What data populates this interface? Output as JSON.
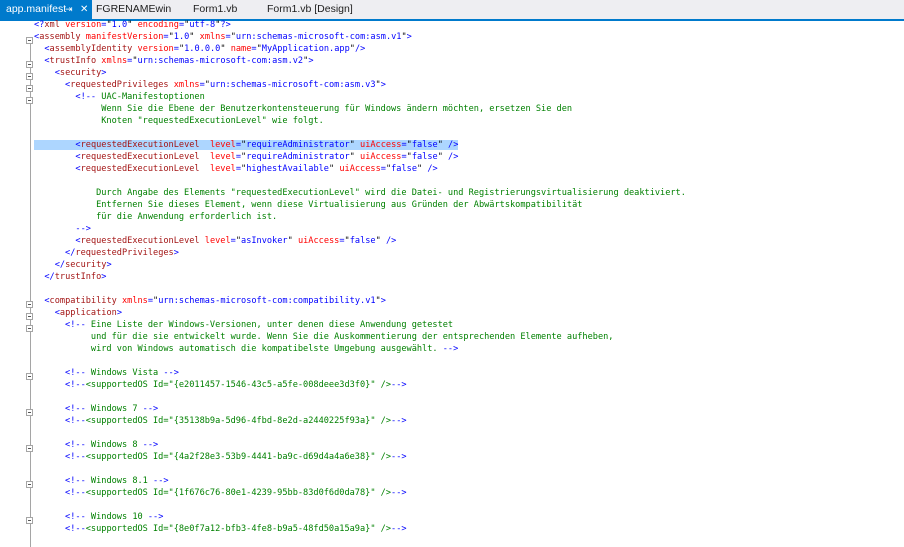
{
  "tabs": [
    {
      "label": "app.manifest",
      "active": true,
      "pin_glyph": "⇥",
      "close_glyph": "✕"
    },
    {
      "label": "FGRENAMEwin",
      "active": false
    },
    {
      "label": "Form1.vb",
      "active": false
    },
    {
      "label": "Form1.vb [Design]",
      "active": false
    }
  ],
  "colors": {
    "accent": "#007acc",
    "selection": "#add6ff",
    "element": "#a31515",
    "attribute": "#ff0000",
    "value": "#0000ff",
    "comment": "#008000"
  },
  "lines": [
    [
      [
        "b",
        "<?"
      ],
      [
        "e",
        "xml"
      ],
      [
        "a",
        " version"
      ],
      [
        "b",
        "="
      ],
      [
        "t",
        "\""
      ],
      [
        "v",
        "1.0"
      ],
      [
        "t",
        "\""
      ],
      [
        "a",
        " encoding"
      ],
      [
        "b",
        "="
      ],
      [
        "t",
        "\""
      ],
      [
        "v",
        "utf-8"
      ],
      [
        "t",
        "\""
      ],
      [
        "b",
        "?>"
      ]
    ],
    [
      [
        "b",
        "<"
      ],
      [
        "e",
        "assembly"
      ],
      [
        "a",
        " manifestVersion"
      ],
      [
        "b",
        "="
      ],
      [
        "t",
        "\""
      ],
      [
        "v",
        "1.0"
      ],
      [
        "t",
        "\""
      ],
      [
        "a",
        " xmlns"
      ],
      [
        "b",
        "="
      ],
      [
        "t",
        "\""
      ],
      [
        "v",
        "urn:schemas-microsoft-com:asm.v1"
      ],
      [
        "t",
        "\""
      ],
      [
        "b",
        ">"
      ]
    ],
    [
      [
        "t",
        "  "
      ],
      [
        "b",
        "<"
      ],
      [
        "e",
        "assemblyIdentity"
      ],
      [
        "a",
        " version"
      ],
      [
        "b",
        "="
      ],
      [
        "t",
        "\""
      ],
      [
        "v",
        "1.0.0.0"
      ],
      [
        "t",
        "\""
      ],
      [
        "a",
        " name"
      ],
      [
        "b",
        "="
      ],
      [
        "t",
        "\""
      ],
      [
        "v",
        "MyApplication.app"
      ],
      [
        "t",
        "\""
      ],
      [
        "b",
        "/>"
      ]
    ],
    [
      [
        "t",
        "  "
      ],
      [
        "b",
        "<"
      ],
      [
        "e",
        "trustInfo"
      ],
      [
        "a",
        " xmlns"
      ],
      [
        "b",
        "="
      ],
      [
        "t",
        "\""
      ],
      [
        "v",
        "urn:schemas-microsoft-com:asm.v2"
      ],
      [
        "t",
        "\""
      ],
      [
        "b",
        ">"
      ]
    ],
    [
      [
        "t",
        "    "
      ],
      [
        "b",
        "<"
      ],
      [
        "e",
        "security"
      ],
      [
        "b",
        ">"
      ]
    ],
    [
      [
        "t",
        "      "
      ],
      [
        "b",
        "<"
      ],
      [
        "e",
        "requestedPrivileges"
      ],
      [
        "a",
        " xmlns"
      ],
      [
        "b",
        "="
      ],
      [
        "t",
        "\""
      ],
      [
        "v",
        "urn:schemas-microsoft-com:asm.v3"
      ],
      [
        "t",
        "\""
      ],
      [
        "b",
        ">"
      ]
    ],
    [
      [
        "t",
        "        "
      ],
      [
        "b",
        "<!--"
      ],
      [
        "c",
        " UAC-Manifestoptionen"
      ]
    ],
    [
      [
        "c",
        "             Wenn Sie die Ebene der Benutzerkontensteuerung für Windows ändern möchten, ersetzen Sie den"
      ]
    ],
    [
      [
        "c",
        "             Knoten \"requestedExecutionLevel\" wie folgt."
      ]
    ],
    [
      [
        "t",
        ""
      ]
    ],
    [
      [
        "t",
        "        "
      ],
      [
        "b",
        "<"
      ],
      [
        "e",
        "requestedExecutionLevel"
      ],
      [
        "a",
        "  level"
      ],
      [
        "b",
        "="
      ],
      [
        "t",
        "\""
      ],
      [
        "v",
        "requireAdministrator"
      ],
      [
        "t",
        "\""
      ],
      [
        "a",
        " uiAccess"
      ],
      [
        "b",
        "="
      ],
      [
        "t",
        "\""
      ],
      [
        "v",
        "false"
      ],
      [
        "t",
        "\""
      ],
      [
        "b",
        " />"
      ]
    ],
    [
      [
        "t",
        "        "
      ],
      [
        "b",
        "<"
      ],
      [
        "e",
        "requestedExecutionLevel"
      ],
      [
        "a",
        "  level"
      ],
      [
        "b",
        "="
      ],
      [
        "t",
        "\""
      ],
      [
        "v",
        "requireAdministrator"
      ],
      [
        "t",
        "\""
      ],
      [
        "a",
        " uiAccess"
      ],
      [
        "b",
        "="
      ],
      [
        "t",
        "\""
      ],
      [
        "v",
        "false"
      ],
      [
        "t",
        "\""
      ],
      [
        "b",
        " />"
      ]
    ],
    [
      [
        "t",
        "        "
      ],
      [
        "b",
        "<"
      ],
      [
        "e",
        "requestedExecutionLevel"
      ],
      [
        "a",
        "  level"
      ],
      [
        "b",
        "="
      ],
      [
        "t",
        "\""
      ],
      [
        "v",
        "highestAvailable"
      ],
      [
        "t",
        "\""
      ],
      [
        "a",
        " uiAccess"
      ],
      [
        "b",
        "="
      ],
      [
        "t",
        "\""
      ],
      [
        "v",
        "false"
      ],
      [
        "t",
        "\""
      ],
      [
        "b",
        " />"
      ]
    ],
    [
      [
        "t",
        ""
      ]
    ],
    [
      [
        "c",
        "            Durch Angabe des Elements \"requestedExecutionLevel\" wird die Datei- und Registrierungsvirtualisierung deaktiviert."
      ]
    ],
    [
      [
        "c",
        "            Entfernen Sie dieses Element, wenn diese Virtualisierung aus Gründen der Abwärtskompatibilität"
      ]
    ],
    [
      [
        "c",
        "            für die Anwendung erforderlich ist."
      ]
    ],
    [
      [
        "t",
        "        "
      ],
      [
        "b",
        "-->"
      ]
    ],
    [
      [
        "t",
        "        "
      ],
      [
        "b",
        "<"
      ],
      [
        "e",
        "requestedExecutionLevel"
      ],
      [
        "a",
        " level"
      ],
      [
        "b",
        "="
      ],
      [
        "t",
        "\""
      ],
      [
        "v",
        "asInvoker"
      ],
      [
        "t",
        "\""
      ],
      [
        "a",
        " uiAccess"
      ],
      [
        "b",
        "="
      ],
      [
        "t",
        "\""
      ],
      [
        "v",
        "false"
      ],
      [
        "t",
        "\""
      ],
      [
        "b",
        " />"
      ]
    ],
    [
      [
        "t",
        "      "
      ],
      [
        "b",
        "</"
      ],
      [
        "e",
        "requestedPrivileges"
      ],
      [
        "b",
        ">"
      ]
    ],
    [
      [
        "t",
        "    "
      ],
      [
        "b",
        "</"
      ],
      [
        "e",
        "security"
      ],
      [
        "b",
        ">"
      ]
    ],
    [
      [
        "t",
        "  "
      ],
      [
        "b",
        "</"
      ],
      [
        "e",
        "trustInfo"
      ],
      [
        "b",
        ">"
      ]
    ],
    [
      [
        "t",
        ""
      ]
    ],
    [
      [
        "t",
        "  "
      ],
      [
        "b",
        "<"
      ],
      [
        "e",
        "compatibility"
      ],
      [
        "a",
        " xmlns"
      ],
      [
        "b",
        "="
      ],
      [
        "t",
        "\""
      ],
      [
        "v",
        "urn:schemas-microsoft-com:compatibility.v1"
      ],
      [
        "t",
        "\""
      ],
      [
        "b",
        ">"
      ]
    ],
    [
      [
        "t",
        "    "
      ],
      [
        "b",
        "<"
      ],
      [
        "e",
        "application"
      ],
      [
        "b",
        ">"
      ]
    ],
    [
      [
        "t",
        "      "
      ],
      [
        "b",
        "<!--"
      ],
      [
        "c",
        " Eine Liste der Windows-Versionen, unter denen diese Anwendung getestet"
      ]
    ],
    [
      [
        "c",
        "           und für die sie entwickelt wurde. Wenn Sie die Auskommentierung der entsprechenden Elemente aufheben,"
      ]
    ],
    [
      [
        "c",
        "           wird von Windows automatisch die kompatibelste Umgebung ausgewählt. "
      ],
      [
        "b",
        "-->"
      ]
    ],
    [
      [
        "t",
        ""
      ]
    ],
    [
      [
        "t",
        "      "
      ],
      [
        "b",
        "<!--"
      ],
      [
        "c",
        " Windows Vista "
      ],
      [
        "b",
        "-->"
      ]
    ],
    [
      [
        "t",
        "      "
      ],
      [
        "b",
        "<!--"
      ],
      [
        "c",
        "<supportedOS Id=\"{e2011457-1546-43c5-a5fe-008deee3d3f0}\" />"
      ],
      [
        "b",
        "-->"
      ]
    ],
    [
      [
        "t",
        ""
      ]
    ],
    [
      [
        "t",
        "      "
      ],
      [
        "b",
        "<!--"
      ],
      [
        "c",
        " Windows 7 "
      ],
      [
        "b",
        "-->"
      ]
    ],
    [
      [
        "t",
        "      "
      ],
      [
        "b",
        "<!--"
      ],
      [
        "c",
        "<supportedOS Id=\"{35138b9a-5d96-4fbd-8e2d-a2440225f93a}\" />"
      ],
      [
        "b",
        "-->"
      ]
    ],
    [
      [
        "t",
        ""
      ]
    ],
    [
      [
        "t",
        "      "
      ],
      [
        "b",
        "<!--"
      ],
      [
        "c",
        " Windows 8 "
      ],
      [
        "b",
        "-->"
      ]
    ],
    [
      [
        "t",
        "      "
      ],
      [
        "b",
        "<!--"
      ],
      [
        "c",
        "<supportedOS Id=\"{4a2f28e3-53b9-4441-ba9c-d69d4a4a6e38}\" />"
      ],
      [
        "b",
        "-->"
      ]
    ],
    [
      [
        "t",
        ""
      ]
    ],
    [
      [
        "t",
        "      "
      ],
      [
        "b",
        "<!--"
      ],
      [
        "c",
        " Windows 8.1 "
      ],
      [
        "b",
        "-->"
      ]
    ],
    [
      [
        "t",
        "      "
      ],
      [
        "b",
        "<!--"
      ],
      [
        "c",
        "<supportedOS Id=\"{1f676c76-80e1-4239-95bb-83d0f6d0da78}\" />"
      ],
      [
        "b",
        "-->"
      ]
    ],
    [
      [
        "t",
        ""
      ]
    ],
    [
      [
        "t",
        "      "
      ],
      [
        "b",
        "<!--"
      ],
      [
        "c",
        " Windows 10 "
      ],
      [
        "b",
        "-->"
      ]
    ],
    [
      [
        "t",
        "      "
      ],
      [
        "b",
        "<!--"
      ],
      [
        "c",
        "<supportedOS Id=\"{8e0f7a12-bfb3-4fe8-b9a5-48fd50a15a9a}\" />"
      ],
      [
        "b",
        "-->"
      ]
    ]
  ],
  "selected_line_index": 10
}
